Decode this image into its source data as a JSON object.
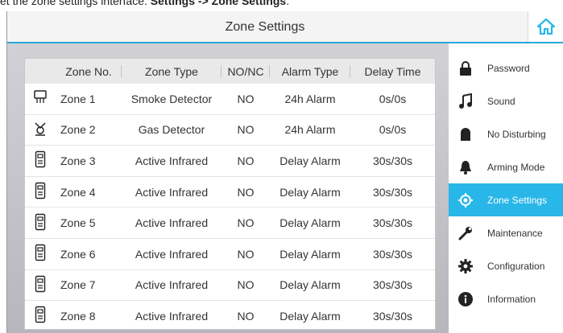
{
  "caption": {
    "prefix": "et the zone settings interface. ",
    "path_start": "Settings",
    "arrow": " -> ",
    "path_end": "Zone Settings",
    "suffix": "."
  },
  "header": {
    "title": "Zone Settings",
    "home_icon": "home-icon"
  },
  "table": {
    "columns": [
      "Zone No.",
      "Zone Type",
      "NO/NC",
      "Alarm Type",
      "Delay Time"
    ],
    "rows": [
      {
        "icon": "smoke-detector-icon",
        "zone": "Zone 1",
        "type": "Smoke Detector",
        "nonc": "NO",
        "alarm": "24h Alarm",
        "delay": "0s/0s"
      },
      {
        "icon": "gas-detector-icon",
        "zone": "Zone 2",
        "type": "Gas Detector",
        "nonc": "NO",
        "alarm": "24h Alarm",
        "delay": "0s/0s"
      },
      {
        "icon": "infrared-sensor-icon",
        "zone": "Zone 3",
        "type": "Active Infrared",
        "nonc": "NO",
        "alarm": "Delay Alarm",
        "delay": "30s/30s"
      },
      {
        "icon": "infrared-sensor-icon",
        "zone": "Zone 4",
        "type": "Active Infrared",
        "nonc": "NO",
        "alarm": "Delay Alarm",
        "delay": "30s/30s"
      },
      {
        "icon": "infrared-sensor-icon",
        "zone": "Zone 5",
        "type": "Active Infrared",
        "nonc": "NO",
        "alarm": "Delay Alarm",
        "delay": "30s/30s"
      },
      {
        "icon": "infrared-sensor-icon",
        "zone": "Zone 6",
        "type": "Active Infrared",
        "nonc": "NO",
        "alarm": "Delay Alarm",
        "delay": "30s/30s"
      },
      {
        "icon": "infrared-sensor-icon",
        "zone": "Zone 7",
        "type": "Active Infrared",
        "nonc": "NO",
        "alarm": "Delay Alarm",
        "delay": "30s/30s"
      },
      {
        "icon": "infrared-sensor-icon",
        "zone": "Zone 8",
        "type": "Active Infrared",
        "nonc": "NO",
        "alarm": "Delay Alarm",
        "delay": "30s/30s"
      }
    ]
  },
  "sidebar": {
    "items": [
      {
        "label": "Password",
        "icon": "lock-icon"
      },
      {
        "label": "Sound",
        "icon": "music-note-icon"
      },
      {
        "label": "No Disturbing",
        "icon": "moon-icon"
      },
      {
        "label": "Arming Mode",
        "icon": "bell-icon"
      },
      {
        "label": "Zone Settings",
        "icon": "crosshair-icon"
      },
      {
        "label": "Maintenance",
        "icon": "wrench-icon"
      },
      {
        "label": "Configuration",
        "icon": "gear-icon"
      },
      {
        "label": "Information",
        "icon": "info-icon"
      }
    ],
    "active": "Zone Settings"
  },
  "colors": {
    "accent": "#29b6e8",
    "icon": "#222222"
  }
}
